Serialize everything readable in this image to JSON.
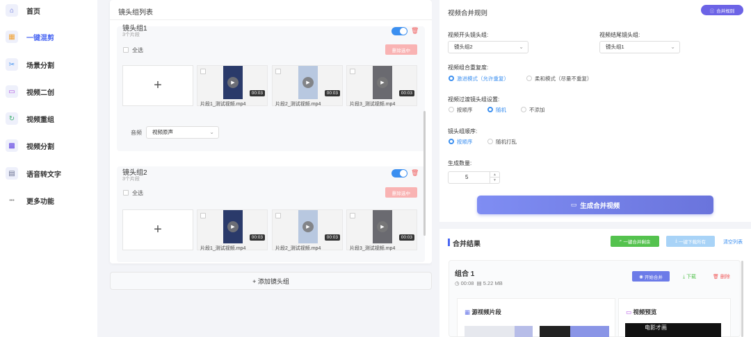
{
  "sidebar": {
    "items": [
      {
        "label": "首页",
        "icon": "home-icon",
        "glyph": "⌂",
        "color": "#5b6ad8"
      },
      {
        "label": "一键混剪",
        "icon": "grid-icon",
        "glyph": "▦",
        "color": "#f0a030",
        "active": true
      },
      {
        "label": "场景分割",
        "icon": "scissors-icon",
        "glyph": "✂",
        "color": "#3b8ff0"
      },
      {
        "label": "视频二创",
        "icon": "video-icon",
        "glyph": "▭",
        "color": "#b050e0"
      },
      {
        "label": "视频重组",
        "icon": "refresh-icon",
        "glyph": "↻",
        "color": "#40b070"
      },
      {
        "label": "视频分割",
        "icon": "tiles-icon",
        "glyph": "▩",
        "color": "#5b3de0"
      },
      {
        "label": "语音转文字",
        "icon": "document-icon",
        "glyph": "▤",
        "color": "#6a7090"
      },
      {
        "label": "更多功能",
        "icon": "more-icon",
        "glyph": "•••",
        "color": "#777777"
      }
    ]
  },
  "left": {
    "title": "镜头组列表",
    "add_group": "+ 添加镜头组",
    "groups": [
      {
        "name": "镜头组1",
        "count": "3个片段",
        "select_all": "全选",
        "delete_selected": "删除选中",
        "audio_label": "音频",
        "audio_value": "视频原声",
        "clips": [
          {
            "name": "片段1_测试视频.mp4",
            "duration": "00:03"
          },
          {
            "name": "片段2_测试视频.mp4",
            "duration": "00:03"
          },
          {
            "name": "片段3_测试视频.mp4",
            "duration": "00:03"
          }
        ]
      },
      {
        "name": "镜头组2",
        "count": "3个片段",
        "select_all": "全选",
        "delete_selected": "删除选中",
        "clips": [
          {
            "name": "片段1_测试视频.mp4",
            "duration": "00:03"
          },
          {
            "name": "片段2_测试视频.mp4",
            "duration": "00:03"
          },
          {
            "name": "片段3_测试视频.mp4",
            "duration": "00:03"
          }
        ]
      }
    ]
  },
  "rules": {
    "title": "视频合并规则",
    "rules_button": "合并规则",
    "opening_label": "视频开头镜头组:",
    "opening_value": "镜头组2",
    "ending_label": "视频结尾镜头组:",
    "ending_value": "镜头组1",
    "repeat_label": "视频组合重复度:",
    "repeat_options": [
      "激进模式（允许重复）",
      "柔和模式（尽量不重复）"
    ],
    "transition_label": "视频过渡镜头组设置:",
    "transition_options": [
      "按顺序",
      "随机",
      "不添加"
    ],
    "order_label": "镜头组顺序:",
    "order_options": [
      "按顺序",
      "随机打乱"
    ],
    "count_label": "生成数量:",
    "count_value": "5",
    "generate_button": "生成合并视频"
  },
  "results": {
    "title": "合并结果",
    "download_all": "一键合并剩余",
    "download_list": "一键下载所有",
    "clear": "清空列表",
    "combo": {
      "title": "组合 1",
      "duration": "00:08",
      "size": "5.22 MB",
      "start": "开始合并",
      "download": "下载",
      "delete": "删除",
      "source_title": "源视频片段",
      "preview_title": "视频预览",
      "preview_caption": "电影才画"
    }
  },
  "colors": {
    "accent": "#4a67f2",
    "toggle": "#3b8ff0",
    "danger": "#f05a5a",
    "success": "#54c24e"
  }
}
